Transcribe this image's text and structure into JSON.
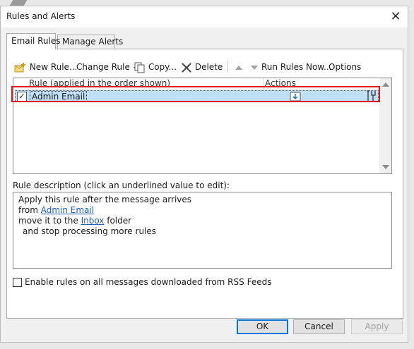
{
  "window": {
    "title": "Rules and Alerts",
    "close_glyph": "✕"
  },
  "tabs": [
    {
      "label": "Email Rules"
    },
    {
      "label": "Manage Alerts"
    }
  ],
  "toolbar": {
    "new_rule": "New Rule...",
    "change_rule": "Change Rule",
    "copy": "Copy...",
    "delete": "Delete",
    "run_rules_now": "Run Rules Now...",
    "options": "Options"
  },
  "rules_list": {
    "columns": [
      "Rule (applied in the order shown)",
      "Actions"
    ],
    "rows": [
      {
        "checked": "✓",
        "name": "Admin Email"
      }
    ]
  },
  "description": {
    "label": "Rule description (click an underlined value to edit):",
    "line1": "Apply this rule after the message arrives",
    "line2_prefix": "from ",
    "line2_link": "Admin Email",
    "line3_prefix": "move it to the ",
    "line3_link": "Inbox",
    "line3_suffix": " folder",
    "line4": "and stop processing more rules"
  },
  "rss_option": {
    "label": "Enable rules on all messages downloaded from RSS Feeds"
  },
  "buttons": {
    "ok": "OK",
    "cancel": "Cancel",
    "apply": "Apply"
  },
  "colors": {
    "selection": "#bfe0f8",
    "highlight_border": "#e01b1b",
    "link": "#1f5fb5"
  }
}
